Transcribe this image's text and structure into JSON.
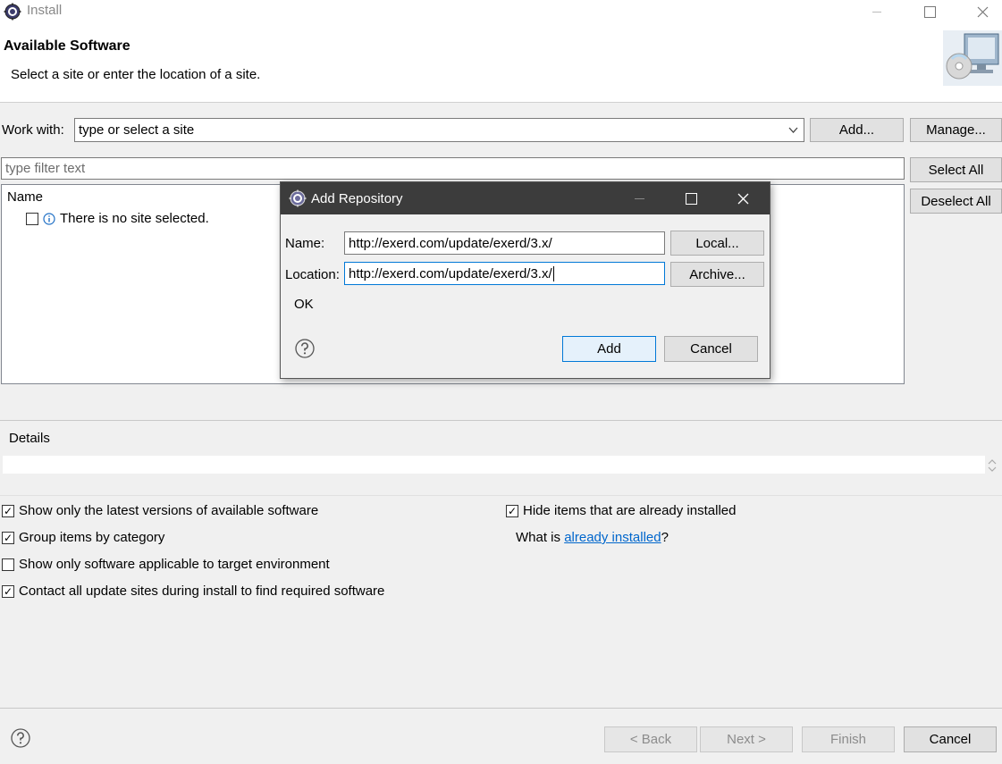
{
  "window": {
    "title": "Install",
    "icon": "eclipse-icon",
    "controls": [
      "minimize-icon",
      "maximize-icon",
      "close-icon"
    ]
  },
  "header": {
    "title": "Available Software",
    "description": "Select a site or enter the location of a site.",
    "banner_icon": "install-software-icon"
  },
  "work_with": {
    "label": "Work with:",
    "value": "type or select a site",
    "add_label": "Add...",
    "manage_label": "Manage..."
  },
  "filter": {
    "placeholder": "type filter text",
    "select_all_label": "Select All",
    "deselect_all_label": "Deselect All"
  },
  "tree": {
    "column_header": "Name",
    "items": [
      {
        "label": "There is no site selected.",
        "checked": false,
        "icon": "info-icon"
      }
    ]
  },
  "details": {
    "label": "Details",
    "text": ""
  },
  "options": {
    "left": [
      {
        "label": "Show only the latest versions of available software",
        "checked": true
      },
      {
        "label": "Group items by category",
        "checked": true
      },
      {
        "label": "Show only software applicable to target environment",
        "checked": false
      },
      {
        "label": "Contact all update sites during install to find required software",
        "checked": true
      }
    ],
    "hide_installed": {
      "label": "Hide items that are already installed",
      "checked": true
    },
    "what_is": {
      "prefix": "What is ",
      "link": "already installed",
      "suffix": "?"
    }
  },
  "footer": {
    "back_label": "< Back",
    "next_label": "Next >",
    "finish_label": "Finish",
    "cancel_label": "Cancel"
  },
  "dialog": {
    "title": "Add Repository",
    "name_label": "Name:",
    "name_value": "http://exerd.com/update/exerd/3.x/",
    "location_label": "Location:",
    "location_value": "http://exerd.com/update/exerd/3.x/",
    "local_label": "Local...",
    "archive_label": "Archive...",
    "status": "OK",
    "add_label": "Add",
    "cancel_label": "Cancel"
  },
  "colors": {
    "accent": "#0078d7",
    "dialog_titlebar": "#3c3c3c",
    "link": "#0066cc"
  }
}
